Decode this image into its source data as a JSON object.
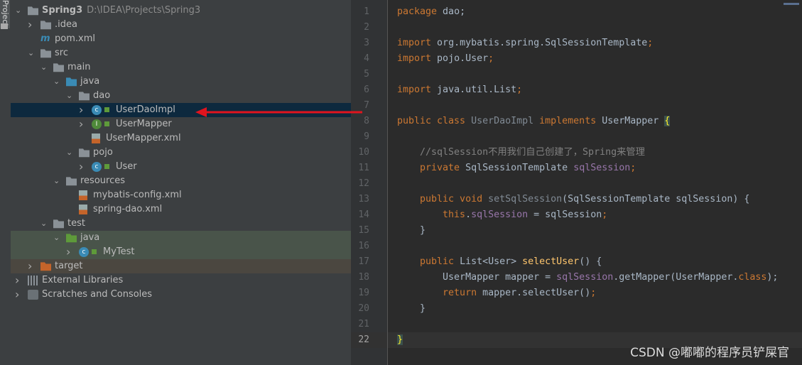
{
  "sidebar_tab": "Project",
  "tree": [
    {
      "label": "Spring3",
      "path": "D:\\IDEA\\Projects\\Spring3",
      "level": 0,
      "arrow": "down",
      "icon": "module-folder-icon",
      "bold": true
    },
    {
      "label": ".idea",
      "level": 1,
      "arrow": "right",
      "icon": "folder-icon"
    },
    {
      "label": "pom.xml",
      "level": 1,
      "icon": "maven-icon"
    },
    {
      "label": "src",
      "level": 1,
      "arrow": "down",
      "icon": "folder-icon"
    },
    {
      "label": "main",
      "level": 2,
      "arrow": "down",
      "icon": "folder-icon"
    },
    {
      "label": "java",
      "level": 3,
      "arrow": "down",
      "icon": "source-folder-icon"
    },
    {
      "label": "dao",
      "level": 4,
      "arrow": "down",
      "icon": "package-icon"
    },
    {
      "label": "UserDaoImpl",
      "level": 5,
      "arrow": "right",
      "icon": "class-icon",
      "lock": true,
      "state": "selected"
    },
    {
      "label": "UserMapper",
      "level": 5,
      "arrow": "right",
      "icon": "interface-icon",
      "lock": true
    },
    {
      "label": "UserMapper.xml",
      "level": 5,
      "icon": "xml-icon"
    },
    {
      "label": "pojo",
      "level": 4,
      "arrow": "down",
      "icon": "package-icon"
    },
    {
      "label": "User",
      "level": 5,
      "arrow": "right",
      "icon": "class-icon",
      "lock": true
    },
    {
      "label": "resources",
      "level": 3,
      "arrow": "down",
      "icon": "resources-folder-icon"
    },
    {
      "label": "mybatis-config.xml",
      "level": 4,
      "icon": "xml-icon"
    },
    {
      "label": "spring-dao.xml",
      "level": 4,
      "icon": "spring-xml-icon"
    },
    {
      "label": "test",
      "level": 2,
      "arrow": "down",
      "icon": "folder-icon"
    },
    {
      "label": "java",
      "level": 3,
      "arrow": "down",
      "icon": "test-folder-icon",
      "state": "test"
    },
    {
      "label": "MyTest",
      "level": 4,
      "arrow": "right",
      "icon": "test-class-icon",
      "lock": true,
      "state": "test"
    },
    {
      "label": "target",
      "level": 1,
      "arrow": "right",
      "icon": "excluded-folder-icon",
      "state": "excluded"
    },
    {
      "label": "External Libraries",
      "level": 0,
      "arrow": "right",
      "icon": "libraries-icon"
    },
    {
      "label": "Scratches and Consoles",
      "level": 0,
      "arrow": "right",
      "icon": "scratches-icon"
    }
  ],
  "code": [
    [
      [
        "package",
        "kw"
      ],
      [
        " dao;",
        ""
      ]
    ],
    [],
    [
      [
        "import",
        "kw"
      ],
      [
        " org.mybatis.spring.SqlSessionTemplate",
        ""
      ],
      [
        ";",
        "kw"
      ]
    ],
    [
      [
        "import",
        "kw"
      ],
      [
        " pojo.User",
        ""
      ],
      [
        ";",
        "kw"
      ]
    ],
    [],
    [
      [
        "import",
        "kw"
      ],
      [
        " java.util.List",
        ""
      ],
      [
        ";",
        "kw"
      ]
    ],
    [],
    [
      [
        "public class ",
        "kw"
      ],
      [
        "UserDaoImpl",
        "un"
      ],
      [
        " implements ",
        "kw"
      ],
      [
        "UserMapper",
        ""
      ],
      [
        " ",
        ""
      ],
      [
        "{",
        "br"
      ]
    ],
    [],
    [
      [
        "    //sqlSession不用我们自己创建了，Spring来管理",
        "cm"
      ]
    ],
    [
      [
        "    private ",
        "kw"
      ],
      [
        "SqlSessionTemplate ",
        ""
      ],
      [
        "sqlSession",
        "fd"
      ],
      [
        ";",
        "kw"
      ]
    ],
    [],
    [
      [
        "    public void ",
        "kw"
      ],
      [
        "setSqlSession",
        "un"
      ],
      [
        "(SqlSessionTemplate sqlSession) {",
        ""
      ]
    ],
    [
      [
        "        this",
        "kw"
      ],
      [
        ".",
        ""
      ],
      [
        "sqlSession",
        "fd"
      ],
      [
        " = sqlSession",
        ""
      ],
      [
        ";",
        "kw"
      ]
    ],
    [
      [
        "    }",
        ""
      ]
    ],
    [],
    [
      [
        "    public ",
        "kw"
      ],
      [
        "List<User> ",
        ""
      ],
      [
        "selectUser",
        "mt"
      ],
      [
        "() {",
        ""
      ]
    ],
    [
      [
        "        UserMapper mapper = ",
        ""
      ],
      [
        "sqlSession",
        "fd"
      ],
      [
        ".getMapper(UserMapper.",
        ""
      ],
      [
        "class",
        "kw"
      ],
      [
        ");",
        ""
      ]
    ],
    [
      [
        "        return ",
        "kw"
      ],
      [
        "mapper.selectUser()",
        ""
      ],
      [
        ";",
        "kw"
      ]
    ],
    [
      [
        "    }",
        ""
      ]
    ],
    [],
    [
      [
        "}",
        "br"
      ]
    ]
  ],
  "current_line": 22,
  "watermark": "CSDN @嘟嘟的程序员铲屎官",
  "colors": {
    "annotation_arrow": "#e0141e",
    "selection": "#0d293e",
    "keyword": "#cc7832"
  }
}
